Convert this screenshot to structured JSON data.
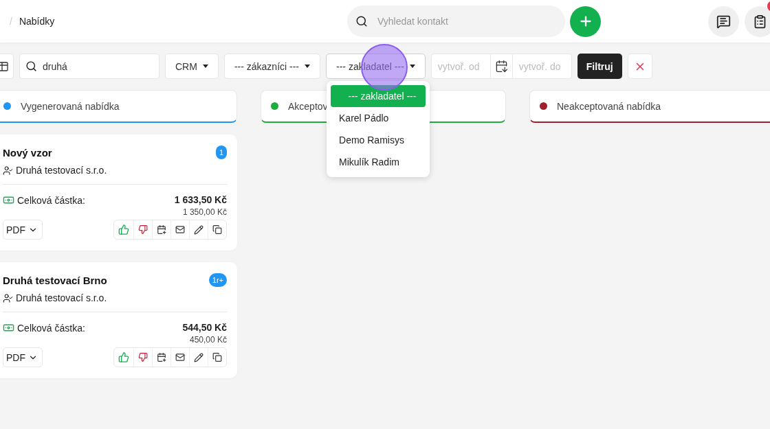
{
  "breadcrumb": {
    "separator": "/",
    "current": "Nabídky"
  },
  "search": {
    "placeholder": "Vyhledat kontakt"
  },
  "header_buttons": [
    {
      "kind": "chat",
      "unread": false
    },
    {
      "kind": "clipboard",
      "unread": true
    }
  ],
  "filters": {
    "search_value": "druhá",
    "selects": [
      {
        "label": "CRM",
        "expanded": false
      },
      {
        "label": "--- zákazníci ---",
        "expanded": false
      },
      {
        "label": "--- zakladatel ---",
        "expanded": true,
        "options": [
          {
            "label": "--- zakladatel ---",
            "selected": true
          },
          {
            "label": "Karel Pádlo",
            "selected": false
          },
          {
            "label": "Demo Ramisys",
            "selected": false
          },
          {
            "label": "Mikulík Radim",
            "selected": false
          }
        ]
      }
    ],
    "date_from": {
      "placeholder": "vytvoř. od"
    },
    "date_to": {
      "placeholder": "vytvoř. do"
    },
    "submit": "Filtruj"
  },
  "columns": [
    {
      "title": "Vygenerovaná nabídka",
      "color": "#2196f3",
      "cards": [
        {
          "title": "Nový vzor",
          "badge": "1",
          "customer": "Druhá testovací s.r.o.",
          "amount_label": "Celková částka:",
          "amount": "1 633,50 Kč",
          "amount_net": "1 350,00 Kč",
          "export": "PDF"
        },
        {
          "title": "Druhá testovací Brno",
          "badge": "1r+",
          "customer": "Druhá testovací s.r.o.",
          "amount_label": "Celková částka:",
          "amount": "544,50 Kč",
          "amount_net": "450,00 Kč",
          "export": "PDF"
        }
      ]
    },
    {
      "title": "Akceptov",
      "color": "#1eaa3c"
    },
    {
      "title": "Neakceptovaná nabídka",
      "color": "#a01e2d"
    }
  ]
}
